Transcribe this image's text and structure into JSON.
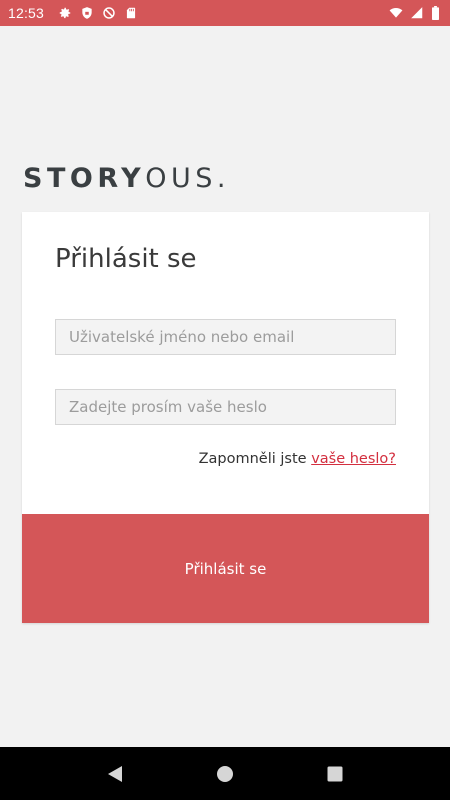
{
  "status_bar": {
    "time": "12:53",
    "left_icons": [
      "gear-icon",
      "shield-icon",
      "do-not-disturb-icon",
      "sd-card-icon"
    ],
    "right_icons": [
      "wifi-icon",
      "signal-icon",
      "battery-icon"
    ]
  },
  "logo": {
    "bold_text": "STORY",
    "light_text": "OUS."
  },
  "login": {
    "title": "Přihlásit se",
    "username_placeholder": "Uživatelské jméno nebo email",
    "password_placeholder": "Zadejte prosím vaše heslo",
    "forgot_prefix": "Zapomněli jste",
    "forgot_link": "vaše heslo?",
    "submit_label": "Přihlásit se"
  },
  "nav_bar": {
    "buttons": [
      "back-icon",
      "home-icon",
      "recents-icon"
    ]
  },
  "colors": {
    "accent": "#d45658",
    "link": "#d32f3f",
    "background": "#f2f2f2"
  }
}
